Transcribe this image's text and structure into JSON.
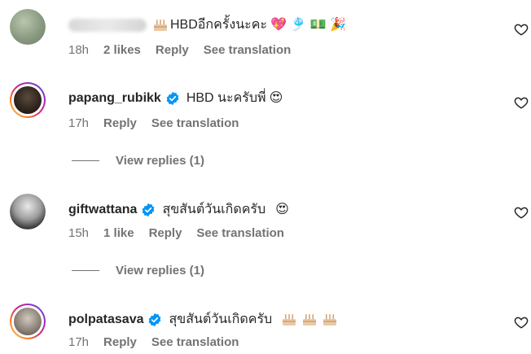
{
  "comments": [
    {
      "username": "",
      "username_blurred": true,
      "text": "HBDอีกครั้งนะคะ",
      "emoji": "💖 🎐 💵 🎉",
      "time": "18h",
      "likes": "2 likes",
      "reply": "Reply",
      "translate": "See translation",
      "verified": false
    },
    {
      "username": "papang_rubikk",
      "text": "HBD นะครับพี่",
      "emoji": "😍",
      "time": "17h",
      "likes": "",
      "reply": "Reply",
      "translate": "See translation",
      "verified": true,
      "view_replies": "View replies (1)"
    },
    {
      "username": "giftwattana",
      "text": "สุขสันต์วันเกิดครับ",
      "emoji": "😍",
      "time": "15h",
      "likes": "1 like",
      "reply": "Reply",
      "translate": "See translation",
      "verified": true,
      "view_replies": "View replies (1)"
    },
    {
      "username": "polpatasava",
      "text": "สุขสันต์วันเกิดครับ",
      "emoji": "",
      "time": "17h",
      "likes": "",
      "reply": "Reply",
      "translate": "See translation",
      "verified": true
    }
  ],
  "icons": {
    "like": "heart-outline-icon",
    "verified": "verified-badge-icon",
    "cake": "birthday-cake-icon"
  },
  "colors": {
    "verified": "#0095f6",
    "meta": "#737373",
    "text": "#262626"
  }
}
